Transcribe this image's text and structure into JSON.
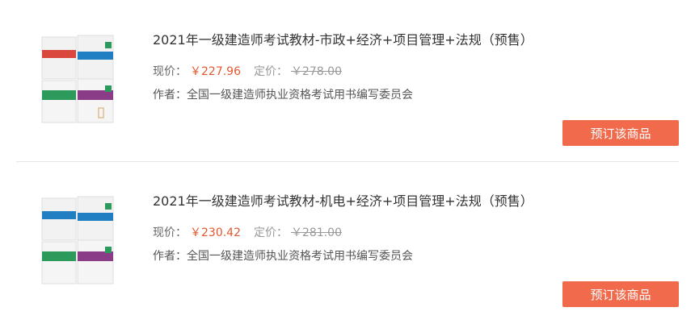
{
  "products": [
    {
      "title": "2021年一级建造师考试教材-市政+经济+项目管理+法规（预售）",
      "price_label": "现价：",
      "price": "￥227.96",
      "list_price_label": "定价：",
      "list_price": "￥278.00",
      "author": "作者：全国一级建造师执业资格考试用书编写委员会",
      "button": "预订该商品"
    },
    {
      "title": "2021年一级建造师考试教材-机电+经济+项目管理+法规（预售）",
      "price_label": "现价：",
      "price": "￥230.42",
      "list_price_label": "定价：",
      "list_price": "￥281.00",
      "author": "作者：全国一级建造师执业资格考试用书编写委员会",
      "button": "预订该商品"
    }
  ],
  "colors": {
    "accent_button": "#f06a4b",
    "price": "#e4572e",
    "book_red": "#d9473d",
    "book_blue": "#1f7fc1",
    "book_green": "#2c9a5a",
    "book_purple": "#8a3c86"
  }
}
